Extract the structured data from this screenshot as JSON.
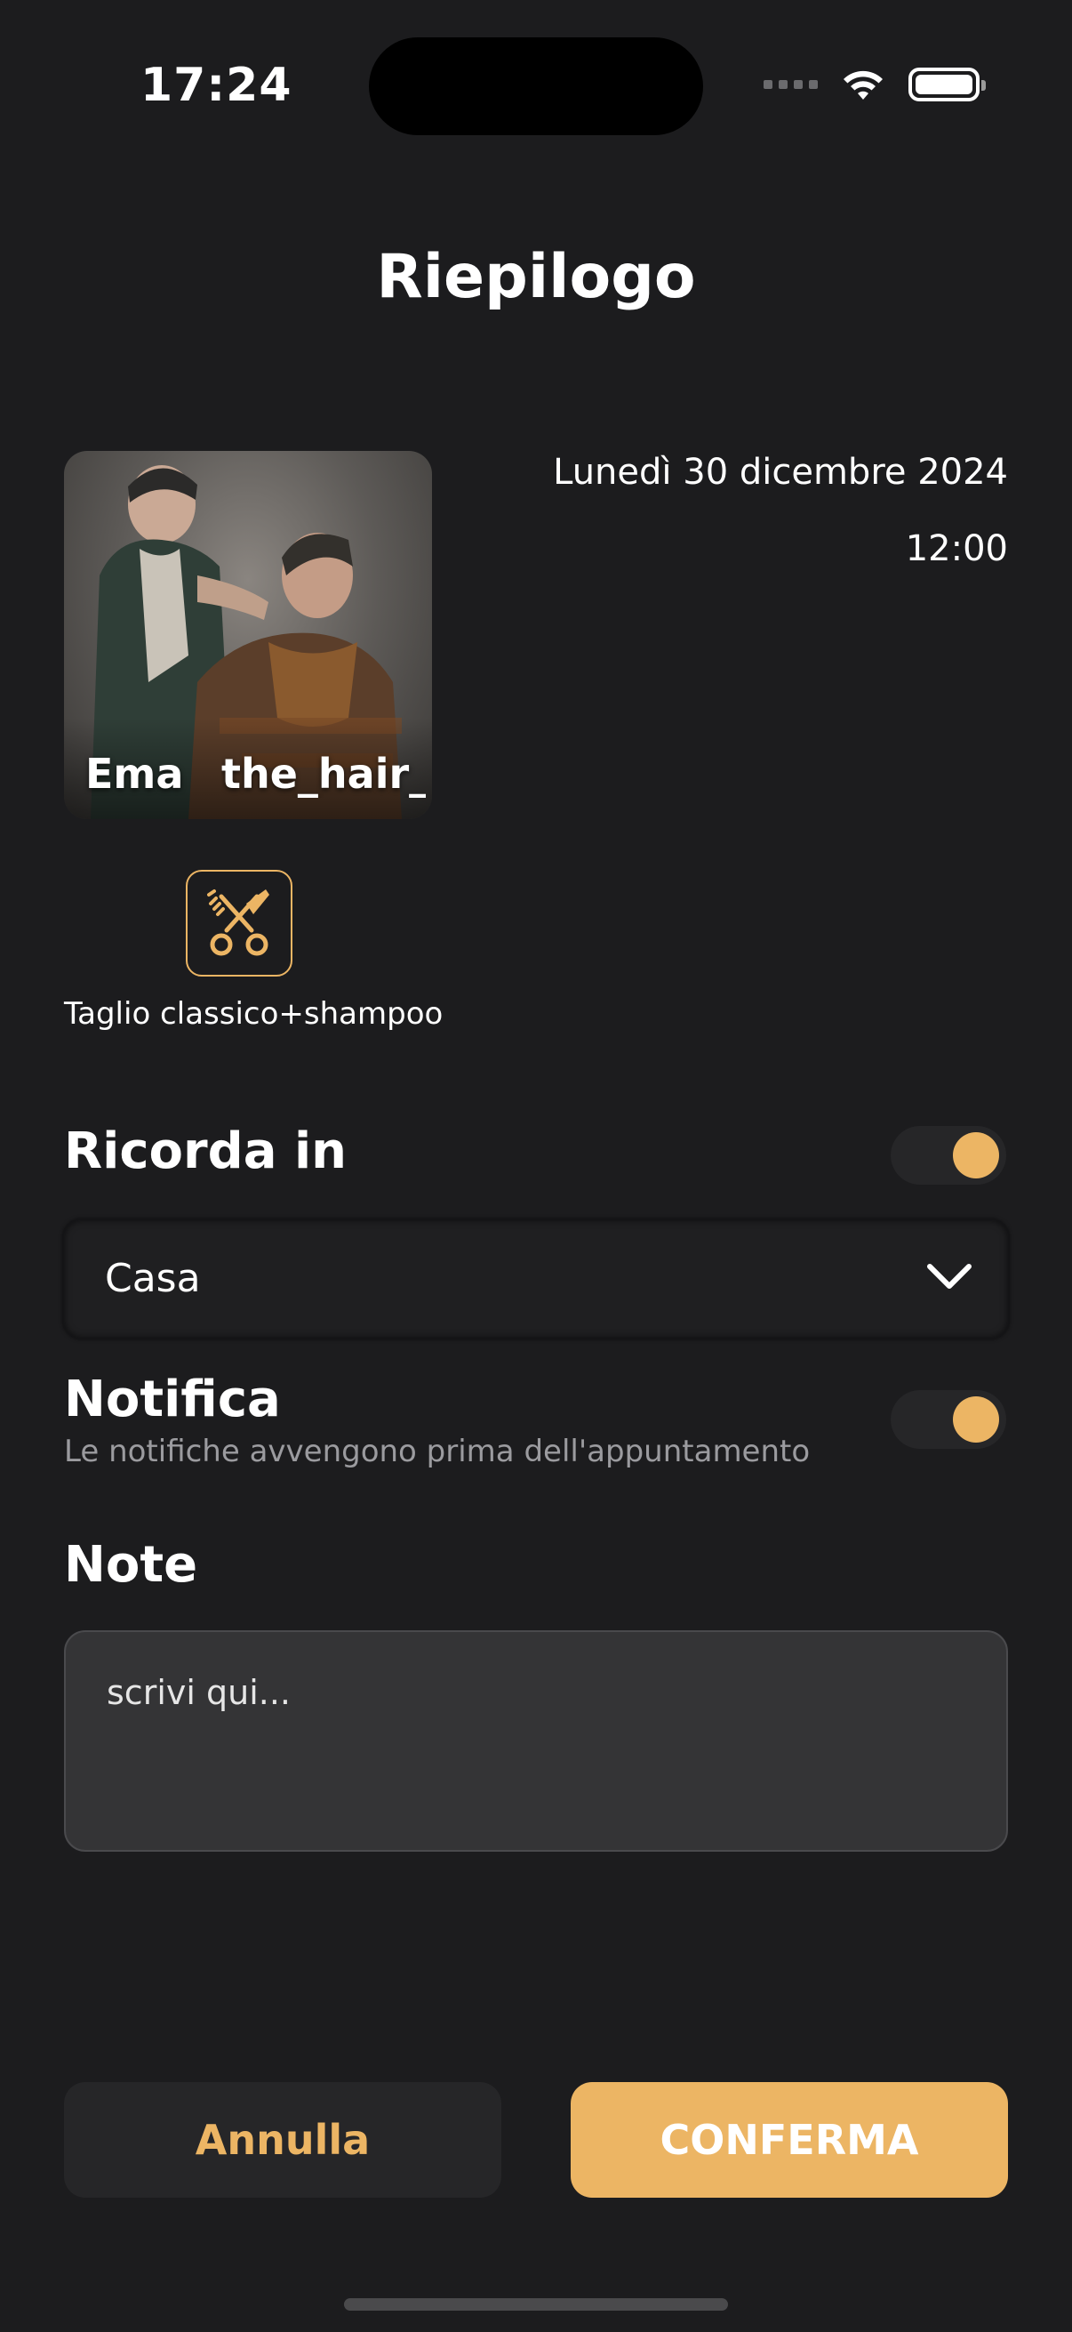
{
  "status_bar": {
    "time": "17:24"
  },
  "header": {
    "title": "Riepilogo"
  },
  "barber": {
    "name": "Ema",
    "handle": "the_hair_s"
  },
  "appointment": {
    "date": "Lunedì 30 dicembre 2024",
    "time": "12:00"
  },
  "service": {
    "label": "Taglio classico+shampoo",
    "icon": "comb-scissors-icon"
  },
  "reminder": {
    "title": "Ricorda in",
    "enabled": true,
    "selected_calendar": "Casa"
  },
  "notification": {
    "title": "Notifica",
    "subtitle": "Le notifiche avvengono prima dell'appuntamento",
    "enabled": true
  },
  "notes": {
    "title": "Note",
    "placeholder": "scrivi qui...",
    "value": ""
  },
  "actions": {
    "cancel_label": "Annulla",
    "confirm_label": "CONFERMA"
  },
  "colors": {
    "accent": "#ecb564",
    "background": "#1c1c1e"
  }
}
